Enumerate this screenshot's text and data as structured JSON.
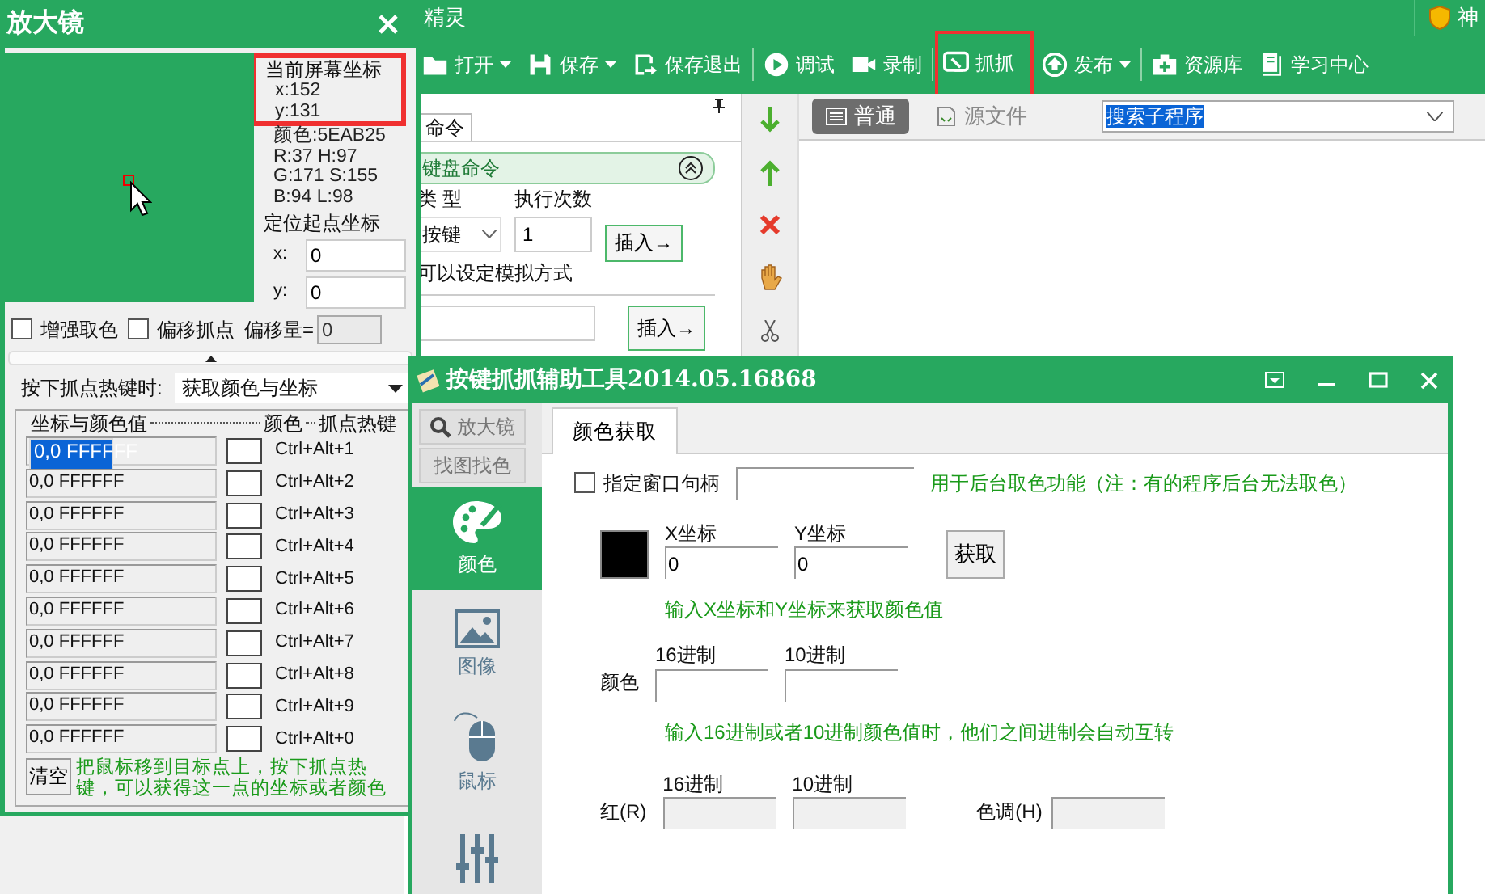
{
  "app": {
    "title": "精灵",
    "shield_text": "神",
    "toolbar": [
      {
        "label": "打开",
        "dropdown": true,
        "highlighted": false
      },
      {
        "label": "保存",
        "dropdown": true,
        "highlighted": false
      },
      {
        "label": "保存退出",
        "dropdown": false,
        "highlighted": false
      },
      {
        "label": "调试",
        "dropdown": false,
        "highlighted": false
      },
      {
        "label": "录制",
        "dropdown": false,
        "highlighted": false
      },
      {
        "label": "抓抓",
        "dropdown": false,
        "highlighted": true
      },
      {
        "label": "发布",
        "dropdown": true,
        "highlighted": false
      },
      {
        "label": "资源库",
        "dropdown": false,
        "highlighted": false
      },
      {
        "label": "学习中心",
        "dropdown": false,
        "highlighted": false
      }
    ],
    "panel_tab": "命令",
    "section": {
      "title": "键盘命令",
      "expanded": true
    },
    "type_label": "类 型",
    "count_label": "执行次数",
    "type_select": "按键",
    "count_value": "1",
    "insert_buttons": [
      "插入→",
      "插入→"
    ],
    "hint": "可以设定模拟方式",
    "editor_tabs": [
      {
        "label": "普通",
        "selected": true
      },
      {
        "label": "源文件",
        "selected": false
      }
    ],
    "search_select": "搜索子程序"
  },
  "magnifier": {
    "title": "放大镜",
    "coords": {
      "title": "当前屏幕坐标",
      "x": "x:152",
      "y": "y:131",
      "highlighted": true
    },
    "color_info": [
      "颜色:5EAB25",
      "R:37  H:97",
      "G:171  S:155",
      "B:94  L:98"
    ],
    "origin": {
      "title": "定位起点坐标",
      "x_label": "x:",
      "x_value": "0",
      "y_label": "y:",
      "y_value": "0"
    },
    "checkboxes": [
      {
        "label": "增强取色",
        "checked": false
      },
      {
        "label": "偏移抓点",
        "checked": false
      }
    ],
    "offset": {
      "label": "偏移量=",
      "value": "0",
      "disabled": true
    },
    "hotkey_label": "按下抓点热键时:",
    "hotkey_select": "获取颜色与坐标",
    "group_headers": [
      "坐标与颜色值",
      "颜色",
      "抓点热键"
    ],
    "rows": [
      {
        "value": "0,0  FFFFFF",
        "selected": true,
        "color": "#ffffff",
        "hotkey": "Ctrl+Alt+1"
      },
      {
        "value": "0,0  FFFFFF",
        "selected": false,
        "color": "#ffffff",
        "hotkey": "Ctrl+Alt+2"
      },
      {
        "value": "0,0  FFFFFF",
        "selected": false,
        "color": "#ffffff",
        "hotkey": "Ctrl+Alt+3"
      },
      {
        "value": "0,0  FFFFFF",
        "selected": false,
        "color": "#ffffff",
        "hotkey": "Ctrl+Alt+4"
      },
      {
        "value": "0,0  FFFFFF",
        "selected": false,
        "color": "#ffffff",
        "hotkey": "Ctrl+Alt+5"
      },
      {
        "value": "0,0  FFFFFF",
        "selected": false,
        "color": "#ffffff",
        "hotkey": "Ctrl+Alt+6"
      },
      {
        "value": "0,0  FFFFFF",
        "selected": false,
        "color": "#ffffff",
        "hotkey": "Ctrl+Alt+7"
      },
      {
        "value": "0,0  FFFFFF",
        "selected": false,
        "color": "#ffffff",
        "hotkey": "Ctrl+Alt+8"
      },
      {
        "value": "0,0  FFFFFF",
        "selected": false,
        "color": "#ffffff",
        "hotkey": "Ctrl+Alt+9"
      },
      {
        "value": "0,0  FFFFFF",
        "selected": false,
        "color": "#ffffff",
        "hotkey": "Ctrl+Alt+0"
      }
    ],
    "clear_button": "清空",
    "note": "把鼠标移到目标点上，按下抓点热键，可以获得这一点的坐标或者颜色"
  },
  "tool": {
    "title": "按键抓抓辅助工具2014.05.16868",
    "sidebar": [
      {
        "kind": "button",
        "label": "放大镜",
        "selected": false
      },
      {
        "kind": "button",
        "label": "找图找色",
        "selected": false
      },
      {
        "kind": "category",
        "label": "颜色",
        "selected": true
      },
      {
        "kind": "category",
        "label": "图像",
        "selected": false
      },
      {
        "kind": "category",
        "label": "鼠标",
        "selected": false
      },
      {
        "kind": "category",
        "selected": false
      }
    ],
    "tabs": [
      {
        "label": "颜色获取",
        "selected": true
      }
    ],
    "handle": {
      "label": "指定窗口句柄",
      "checked": false
    },
    "handle_note": "用于后台取色功能（注：有的程序后台无法取色）",
    "swatch": {
      "color": "#000000"
    },
    "x_label": "X坐标",
    "x_value": "0",
    "y_label": "Y坐标",
    "y_value": "0",
    "get_button": "获取",
    "coord_note": "输入X坐标和Y坐标来获取颜色值",
    "hex_header": "16进制",
    "dec_header": "10进制",
    "color_label": "颜色",
    "convert_note": "输入16进制或者10进制颜色值时，他们之间进制会自动互转",
    "rgb_hex_header": "16进制",
    "rgb_dec_header": "10进制",
    "red_label": "红(R)",
    "hue_label": "色调(H)"
  }
}
